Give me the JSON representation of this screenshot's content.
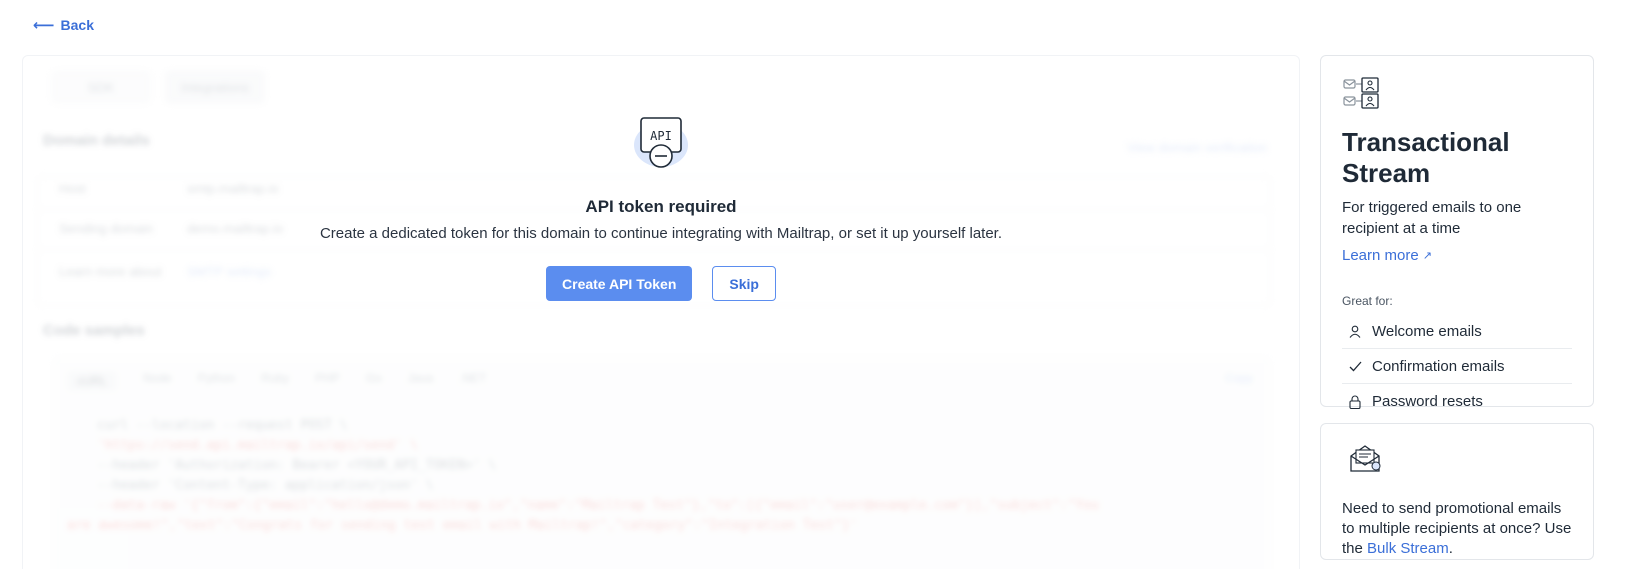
{
  "back": {
    "label": "Back",
    "icon": "arrow-left-icon"
  },
  "background": {
    "tabs": [
      "SDK",
      "Integrations"
    ],
    "domain_section_title": "Domain details",
    "details_link": "View domain verification",
    "rows": [
      {
        "key": "Host",
        "value": "smtp.mailtrap.io"
      },
      {
        "key": "Sending domain",
        "value": "demo.mailtrap.io"
      }
    ],
    "footer_text": "Learn more about",
    "footer_link": "SMTP settings",
    "code_section_title": "Code samples",
    "code_tabs": [
      "cURL",
      "Node",
      "Python",
      "Ruby",
      "PHP",
      "Go",
      "Java",
      ".NET"
    ],
    "code_copy": "Copy",
    "code_lines": [
      "curl --location --request POST \\",
      "'https://send.api.mailtrap.io/api/send' \\",
      "--header 'Authorization: Bearer <YOUR_API_TOKEN>' \\",
      "--header 'Content-Type: application/json' \\",
      "--data-raw '{\"from\":{\"email\":\"hello@demo.mailtrap.io\",\"name\":\"Mailtrap Test\"},\"to\":[{\"email\":\"user@example.com\"}],\"subject\":\"You",
      "are awesome!\",\"text\":\"Congrats for sending test email with Mailtrap!\",\"category\":\"Integration Test\"}'"
    ]
  },
  "modal": {
    "icon_label": "API",
    "title": "API token required",
    "description": "Create a dedicated token for this domain to continue integrating with Mailtrap, or set it up yourself later.",
    "primary_button": "Create API Token",
    "secondary_button": "Skip",
    "primary_color": "#5b8def"
  },
  "stream_card": {
    "title": "Transactional Stream",
    "description": "For triggered emails to one recipient at a time",
    "learn_more": "Learn more",
    "great_for_label": "Great for:",
    "features": [
      {
        "icon": "user-icon",
        "label": "Welcome emails"
      },
      {
        "icon": "check-icon",
        "label": "Confirmation emails"
      },
      {
        "icon": "lock-icon",
        "label": "Password resets"
      }
    ]
  },
  "bulk_card": {
    "text": "Need to send promotional emails to multiple recipients at once? Use the",
    "link": "Bulk Stream",
    "suffix": "."
  },
  "accent_color": "#3b6fd8"
}
